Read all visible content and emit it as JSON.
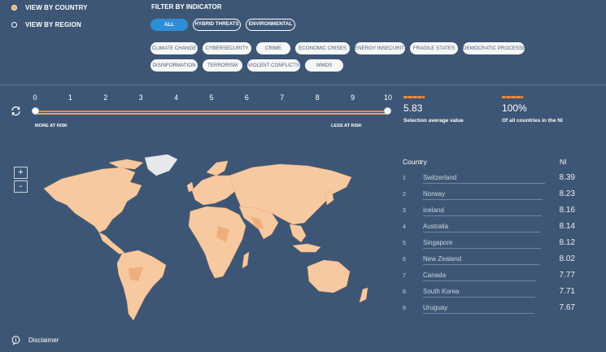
{
  "view": {
    "by_country": "VIEW BY COUNTRY",
    "by_region": "VIEW BY REGION"
  },
  "filter": {
    "title": "FILTER BY INDICATOR",
    "main": [
      "ALL",
      "HYBRID THREATS",
      "ENVIRONMENTAL"
    ],
    "row1": [
      "CLIMATE CHANGE",
      "CYBERSECURITY",
      "CRIME",
      "ECONOMIC CRISES",
      "ENERGY INSECURITY",
      "FRAGILE STATES",
      "DEMOCRATIC PROCESSES"
    ],
    "row2": [
      "DISINFORMATION",
      "TERRORISM",
      "VIOLENT CONFLICTS",
      "WMDS"
    ]
  },
  "slider": {
    "ticks": [
      "0",
      "1",
      "2",
      "3",
      "4",
      "5",
      "6",
      "7",
      "8",
      "9",
      "10"
    ],
    "left_label": "MORE AT RISK",
    "right_label": "LESS AT RISK"
  },
  "stats": {
    "avg_value": "5.83",
    "avg_label": "Selection average value",
    "pct_value": "100%",
    "pct_label": "Of all countries in the NI"
  },
  "zoom": {
    "in": "+",
    "out": "-"
  },
  "ranking": {
    "col_country": "Country",
    "col_score": "NI",
    "rows": [
      {
        "rank": "1",
        "country": "Switzerland",
        "score": "8.39"
      },
      {
        "rank": "2",
        "country": "Norway",
        "score": "8.23"
      },
      {
        "rank": "3",
        "country": "Iceland",
        "score": "8.16"
      },
      {
        "rank": "4",
        "country": "Australia",
        "score": "8.14"
      },
      {
        "rank": "5",
        "country": "Singapore",
        "score": "8.12"
      },
      {
        "rank": "6",
        "country": "New Zealand",
        "score": "8.02"
      },
      {
        "rank": "7",
        "country": "Canada",
        "score": "7.77"
      },
      {
        "rank": "8",
        "country": "South Korea",
        "score": "7.71"
      },
      {
        "rank": "9",
        "country": "Uruguay",
        "score": "7.67"
      }
    ]
  },
  "footer": {
    "disclaimer": "Disclaimer"
  },
  "colors": {
    "accent": "#e98c3a",
    "primary": "#2c8ed6",
    "background": "#3e5675",
    "land": "#f7c9a0"
  }
}
